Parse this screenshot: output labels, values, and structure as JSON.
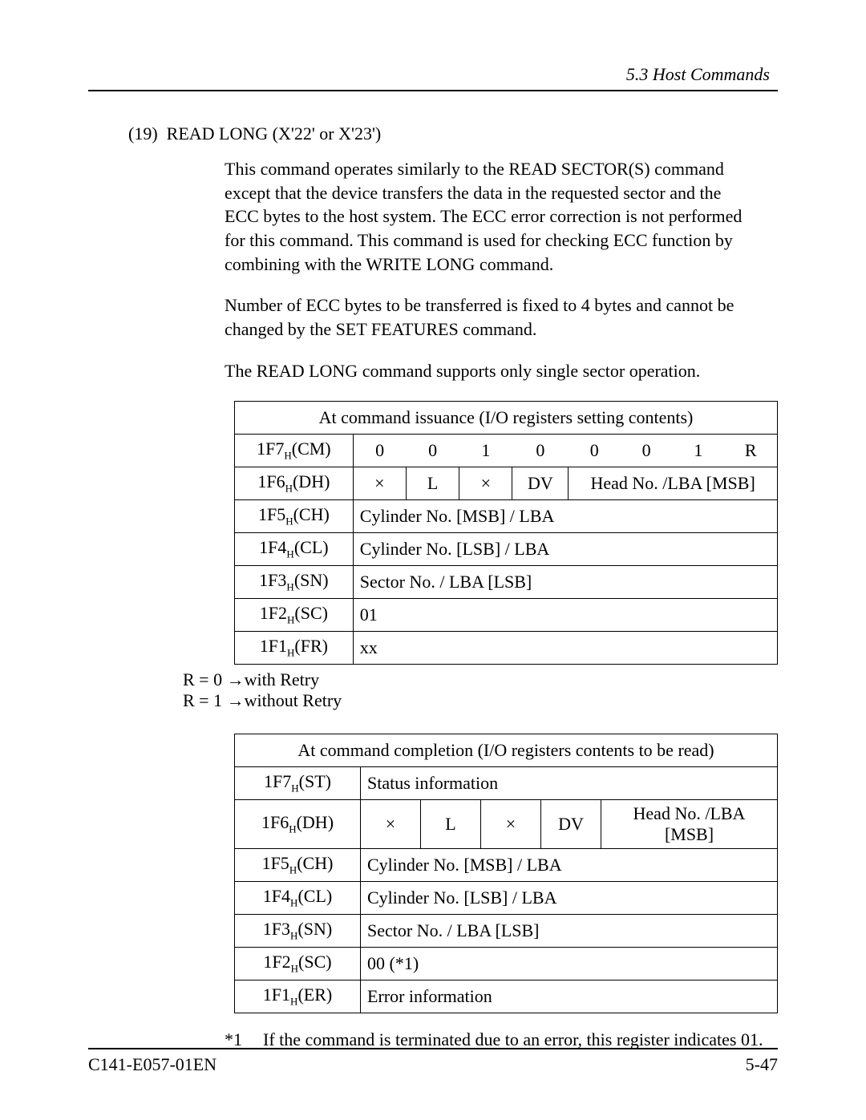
{
  "header": {
    "section": "5.3  Host Commands"
  },
  "section_num": "(19)",
  "section_title": "READ LONG (X'22' or X'23')",
  "paragraphs": {
    "p1": "This command operates similarly to the READ SECTOR(S) command except that the device transfers the data in the requested sector and the ECC bytes to the host system. The ECC error correction is not performed for this command. This command is used for checking ECC function by combining with the WRITE LONG command.",
    "p2": "Number of ECC bytes to be transferred is fixed to 4 bytes and cannot be changed by the SET FEATURES command.",
    "p3": "The READ LONG command supports only single sector operation."
  },
  "table1": {
    "title": "At command issuance (I/O registers setting contents)",
    "rows": {
      "r1_reg": "1F7",
      "r1_regsub": "H",
      "r1_regp": "(CM)",
      "r1_b7": "0",
      "r1_b6": "0",
      "r1_b5": "1",
      "r1_b4": "0",
      "r1_b3": "0",
      "r1_b2": "0",
      "r1_b1": "1",
      "r1_b0": "R",
      "r2_reg": "1F6",
      "r2_regsub": "H",
      "r2_regp": "(DH)",
      "r2_b7": "×",
      "r2_b6": "L",
      "r2_b5": "×",
      "r2_b4": "DV",
      "r2_head": "Head No. /LBA [MSB]",
      "r3_reg": "1F5",
      "r3_regsub": "H",
      "r3_regp": "(CH)",
      "r3_val": "Cylinder No. [MSB] / LBA",
      "r4_reg": "1F4",
      "r4_regsub": "H",
      "r4_regp": "(CL)",
      "r4_val": "Cylinder No. [LSB] / LBA",
      "r5_reg": "1F3",
      "r5_regsub": "H",
      "r5_regp": "(SN)",
      "r5_val": "Sector No. / LBA [LSB]",
      "r6_reg": "1F2",
      "r6_regsub": "H",
      "r6_regp": "(SC)",
      "r6_val": "01",
      "r7_reg": "1F1",
      "r7_regsub": "H",
      "r7_regp": "(FR)",
      "r7_val": "xx"
    }
  },
  "retry": {
    "l1": "R = 0 →with Retry",
    "l2": "R = 1 →without Retry"
  },
  "table2": {
    "title": "At command completion (I/O registers contents to be read)",
    "rows": {
      "r1_reg": "1F7",
      "r1_regsub": "H",
      "r1_regp": "(ST)",
      "r1_val": "Status information",
      "r2_reg": "1F6",
      "r2_regsub": "H",
      "r2_regp": "(DH)",
      "r2_b7": "×",
      "r2_b6": "L",
      "r2_b5": "×",
      "r2_b4": "DV",
      "r2_head": "Head No. /LBA [MSB]",
      "r3_reg": "1F5",
      "r3_regsub": "H",
      "r3_regp": "(CH)",
      "r3_val": "Cylinder No. [MSB] / LBA",
      "r4_reg": "1F4",
      "r4_regsub": "H",
      "r4_regp": "(CL)",
      "r4_val": "Cylinder No. [LSB] / LBA",
      "r5_reg": "1F3",
      "r5_regsub": "H",
      "r5_regp": "(SN)",
      "r5_val": "Sector No. / LBA [LSB]",
      "r6_reg": "1F2",
      "r6_regsub": "H",
      "r6_regp": "(SC)",
      "r6_val": "00 (*1)",
      "r7_reg": "1F1",
      "r7_regsub": "H",
      "r7_regp": "(ER)",
      "r7_val": "Error information"
    }
  },
  "footnote": {
    "mark": "*1",
    "text": "If the command is terminated due to an error, this register indicates 01."
  },
  "footer": {
    "left": "C141-E057-01EN",
    "right": "5-47"
  }
}
